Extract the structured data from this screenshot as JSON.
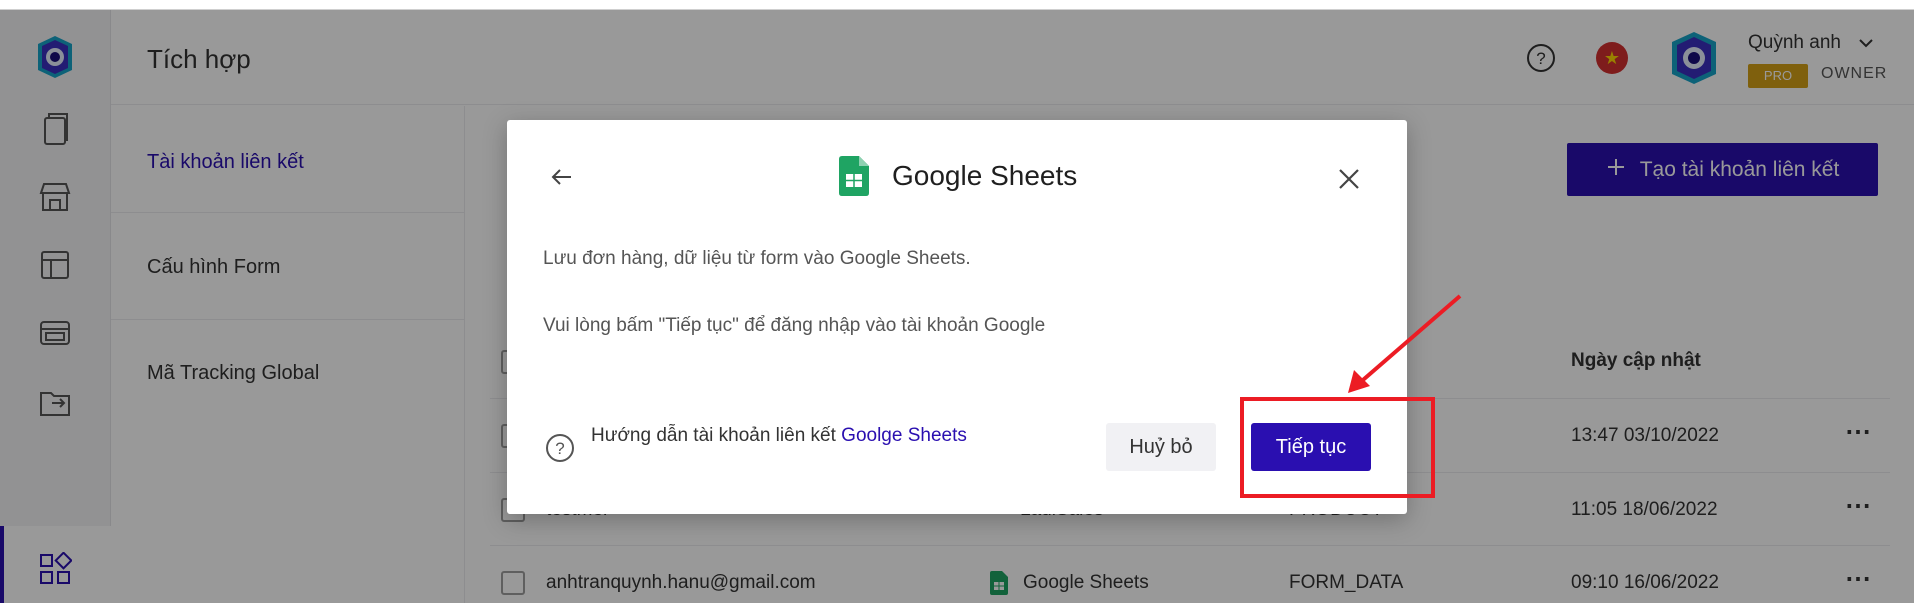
{
  "header": {
    "title": "Tích hợp",
    "user_name": "Quỳnh anh",
    "plan_badge": "PRO",
    "role": "OWNER"
  },
  "sidebar": {
    "icons": [
      "document-icon",
      "store-icon",
      "layout-icon",
      "browser-icon",
      "folder-transfer-icon",
      "apps-icon"
    ],
    "active_index": 5
  },
  "submenu": {
    "items": [
      {
        "label": "Tài khoản liên kết",
        "active": true
      },
      {
        "label": "Cấu hình Form",
        "active": false
      },
      {
        "label": "Mã Tracking Global",
        "active": false
      }
    ]
  },
  "main": {
    "create_button": "Tạo tài khoản liên kết",
    "columns": {
      "updated": "Ngày cập nhật"
    },
    "rows": [
      {
        "name": "",
        "source": "",
        "type": "",
        "updated": "13:47 03/10/2022"
      },
      {
        "name": "testmer",
        "source": "LadiSales",
        "type": "PRODUCT",
        "updated": "11:05 18/06/2022"
      },
      {
        "name": "anhtranquynh.hanu@gmail.com",
        "source": "Google Sheets",
        "type": "FORM_DATA",
        "updated": "09:10 16/06/2022"
      }
    ]
  },
  "modal": {
    "title": "Google Sheets",
    "description": "Lưu đơn hàng, dữ liệu từ form vào Google Sheets.",
    "instruction": "Vui lòng bấm \"Tiếp tục\" để đăng nhập vào tài khoản Google",
    "guide_text": "Hướng dẫn tài khoản liên kết ",
    "guide_link": "Goolge Sheets",
    "cancel_label": "Huỷ bỏ",
    "continue_label": "Tiếp tục"
  },
  "colors": {
    "primary": "#2a0fb0",
    "annotation": "#ec1c24",
    "sheets_green": "#1fa463"
  }
}
